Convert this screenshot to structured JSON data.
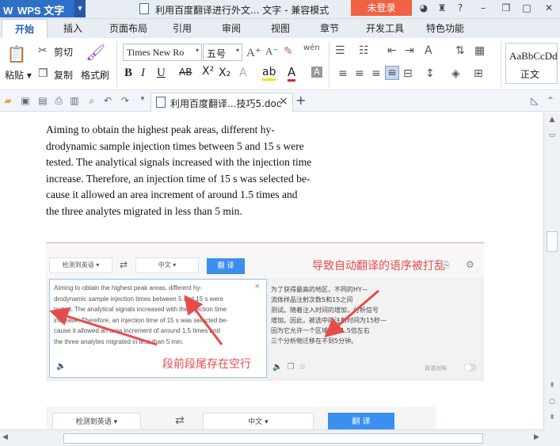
{
  "titlebar": {
    "app_name": "WPS 文字",
    "document_title": "利用百度翻译进行外文... 文字 - 兼容模式",
    "login_label": "未登录"
  },
  "ribbon_tabs": [
    "开始",
    "插入",
    "页面布局",
    "引用",
    "审阅",
    "视图",
    "章节",
    "开发工具",
    "特色功能"
  ],
  "ribbon": {
    "paste": "粘贴",
    "cut": "剪切",
    "copy": "复制",
    "format_painter": "格式刷",
    "font_name": "Times New Ro",
    "font_size": "五号",
    "style_sample": "AaBbCcDd",
    "style_name": "正文"
  },
  "doc_tab": {
    "label": "利用百度翻译...技巧5.doc"
  },
  "document": {
    "lines": [
      "Aiming to obtain the highest peak areas, different hy-",
      "drodynamic sample injection times between 5 and 15 s were",
      "tested. The analytical signals increased with the injection time",
      "increase. Therefore, an injection time of 15 s was selected be-",
      "cause it allowed an area increment of around 1.5 times and",
      "the three analytes migrated in less than 5 min."
    ]
  },
  "embedded": {
    "source_lang": "检测到英语",
    "target_lang": "中文",
    "translate_btn": "翻 译",
    "annotation_top": "导致自动翻译的语序被打乱",
    "annotation_bottom": "段前段尾存在空行",
    "close": "×",
    "source_lines": [
      "Aiming to obtain the highest peak areas, different hy-",
      "drodynamic sample injection times between 5 and 15 s were",
      "tested. The analytical signals increased with the injection time",
      "increase. Therefore, an injection time of 15 s was selected be-",
      "cause it allowed an area increment of around 1.5 times and",
      "the three analytes migrated in less than 5 min."
    ],
    "result_lines": [
      "为了获得最高的地区，不同的HY—",
      "流体样品注射次数5和15之间",
      "测试。随着注入时间的增加，分析信号",
      "增加。因此，被选中的注射时间为15秒—",
      "因为它允许一个区域增加1.5倍左右",
      "三个分析物迁移在不到5分钟。"
    ],
    "toggle_label": "双语对照"
  },
  "embedded2": {
    "source_lang": "检测到英语",
    "target_lang": "中文",
    "translate_btn": "翻 译"
  }
}
